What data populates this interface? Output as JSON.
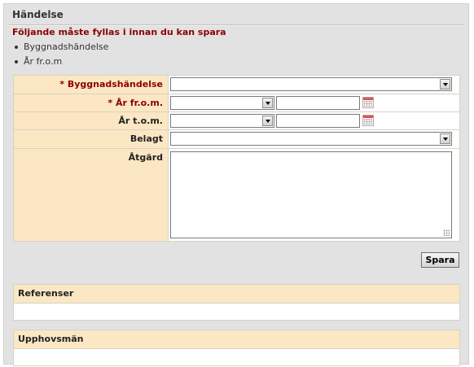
{
  "panel": {
    "title": "Händelse"
  },
  "validation": {
    "heading": "Följande måste fyllas i innan du kan spara",
    "items": [
      "Byggnadshändelse",
      "År fr.o.m"
    ]
  },
  "form": {
    "rows": [
      {
        "label": "Byggnadshändelse",
        "required": true
      },
      {
        "label": "År fr.o.m.",
        "required": true
      },
      {
        "label": "År t.o.m.",
        "required": false
      },
      {
        "label": "Belagt",
        "required": false
      },
      {
        "label": "Åtgärd",
        "required": false
      }
    ],
    "required_marker": "*",
    "byggnadshandelse_value": "",
    "ar_from_select_value": "",
    "ar_from_text_value": "",
    "ar_tom_select_value": "",
    "ar_tom_text_value": "",
    "belagt_value": "",
    "atgard_value": ""
  },
  "buttons": {
    "save_label": "Spara"
  },
  "sections": {
    "references_title": "Referenser",
    "authors_title": "Upphovsmän"
  },
  "icons": {
    "calendar": "calendar-icon",
    "dropdown": "chevron-down-icon"
  },
  "colors": {
    "label_background": "#fbe7c3",
    "required_label": "#8b0000",
    "panel_background": "#e2e2e2"
  }
}
